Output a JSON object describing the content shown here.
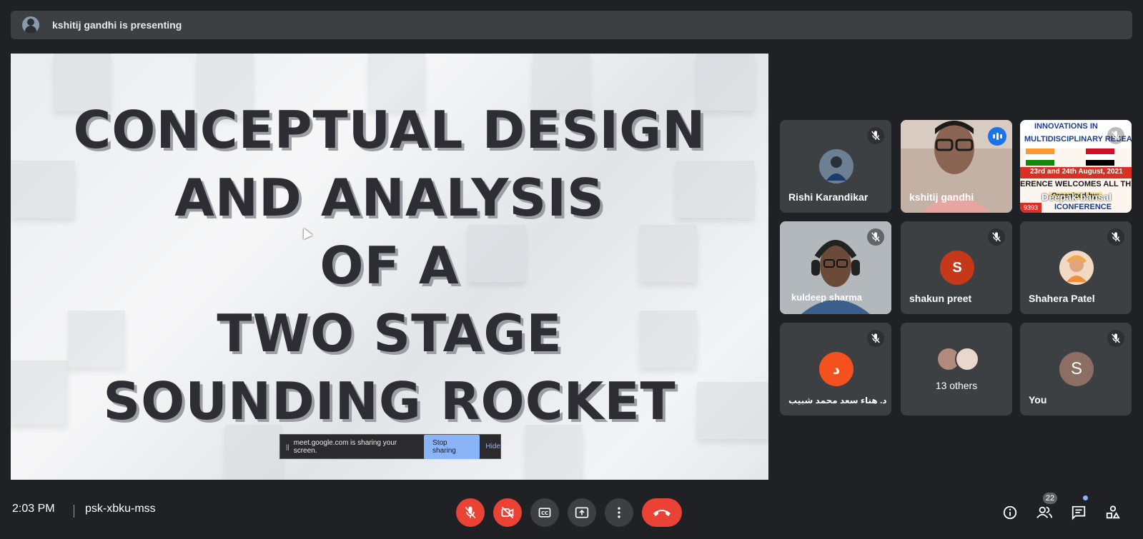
{
  "presenting_banner": {
    "text": "kshitij gandhi is presenting"
  },
  "slide": {
    "lines": [
      "CONCEPTUAL DESIGN",
      "AND ANALYSIS",
      "OF A",
      "TWO STAGE",
      "SOUNDING ROCKET"
    ]
  },
  "share_notice": {
    "pause": "||",
    "message": "meet.google.com is sharing your screen.",
    "stop_label": "Stop sharing",
    "hide_label": "Hide"
  },
  "participants": [
    {
      "name": "Rishi Karandikar",
      "muted": true,
      "avatar": "photo"
    },
    {
      "name": "kshitij gandhi",
      "muted": false,
      "speaking": true,
      "avatar": "video"
    },
    {
      "name": "Deepak bansal",
      "muted": true,
      "avatar": "video",
      "banner_texts": [
        "INNOVATIONS IN",
        "MULTIDISCIPLINARY RESEA",
        "23rd and 24th August, 2021",
        "ERENCE WELCOMES ALL THE DELI",
        "Organized by:",
        "ICONFERENCE",
        "9393"
      ]
    },
    {
      "name": "kuldeep sharma",
      "muted": true,
      "avatar": "video"
    },
    {
      "name": "shakun preet",
      "muted": true,
      "avatar": "initial",
      "initial": "S",
      "color": "#c5391a"
    },
    {
      "name": "Shahera Patel",
      "muted": true,
      "avatar": "photo"
    },
    {
      "name": "د. هناء سعد محمد شبيب",
      "muted": true,
      "avatar": "initial",
      "initial": "د",
      "color": "#f4511e"
    },
    {
      "name": "13 others",
      "avatar": "group"
    },
    {
      "name": "You",
      "muted": true,
      "avatar": "initial",
      "initial": "S",
      "color": "#8d6e63"
    }
  ],
  "bottom_bar": {
    "time": "2:03 PM",
    "meeting_code": "psk-xbku-mss",
    "people_count": "22"
  },
  "colors": {
    "background": "#202124",
    "tile": "#3c4043",
    "danger": "#ea4335",
    "accent": "#8ab4f8"
  },
  "icons": [
    "mic-off-icon",
    "camera-off-icon",
    "captions-icon",
    "present-icon",
    "more-icon",
    "end-call-icon",
    "info-icon",
    "people-icon",
    "chat-icon",
    "activities-icon"
  ]
}
